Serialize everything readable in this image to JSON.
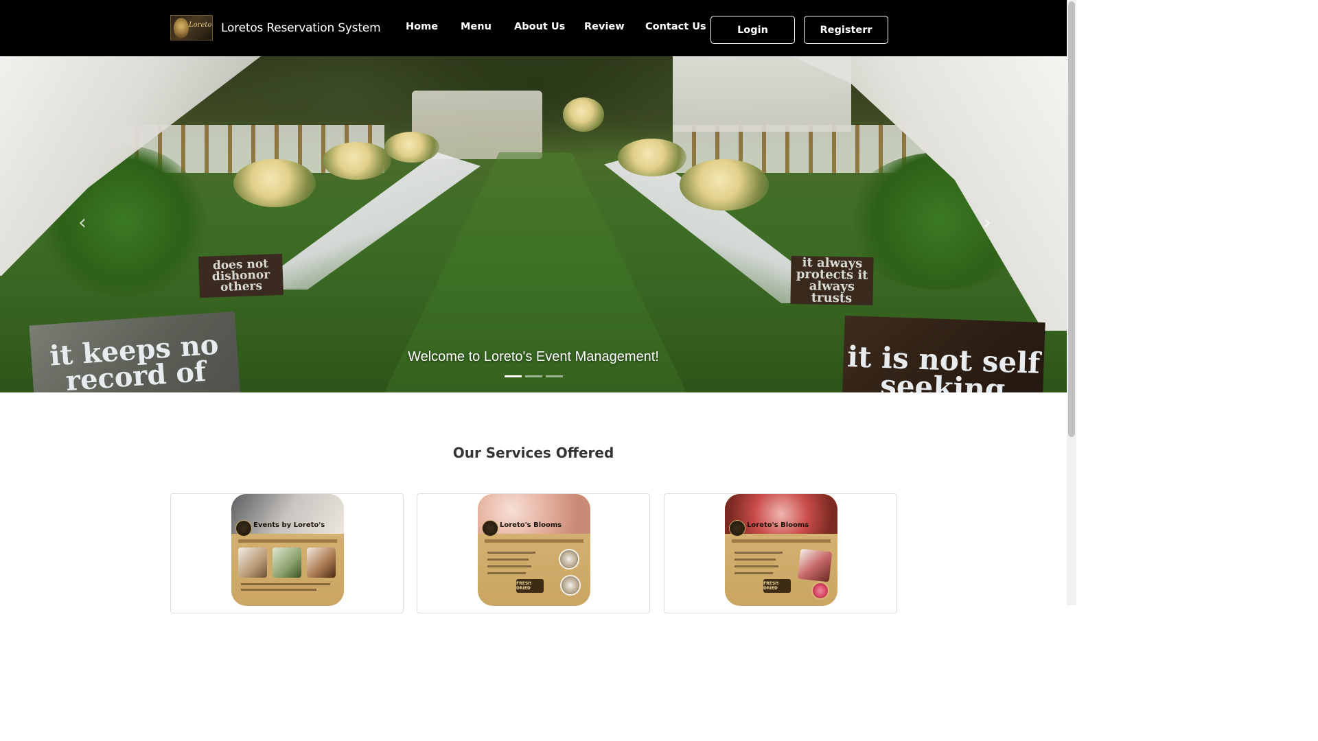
{
  "navbar": {
    "brand_name": "Loretos Reservation System",
    "logo_text": "Loreto's",
    "links": [
      "Home",
      "Menu",
      "About Us",
      "Review",
      "Contact Us"
    ],
    "login_label": "Login",
    "register_label": "Registerr"
  },
  "hero": {
    "caption": "Welcome to Loreto's Event Management!",
    "slide_count": 3,
    "active_slide": 0,
    "signs": {
      "sign1": "it keeps no record of wrong",
      "sign2": "it is not self seeking",
      "sign3": "does not dishonor others",
      "sign4": "it always protects it always trusts"
    }
  },
  "services": {
    "title": "Our Services Offered",
    "cards": [
      {
        "poster_title": "Events by Loreto's"
      },
      {
        "poster_title": "Loreto's Blooms"
      },
      {
        "poster_title": "Loreto's Blooms"
      }
    ]
  },
  "colors": {
    "navbar_bg": "#000000",
    "nav_text": "#ffffff",
    "poster_gold": "#d9b779"
  }
}
